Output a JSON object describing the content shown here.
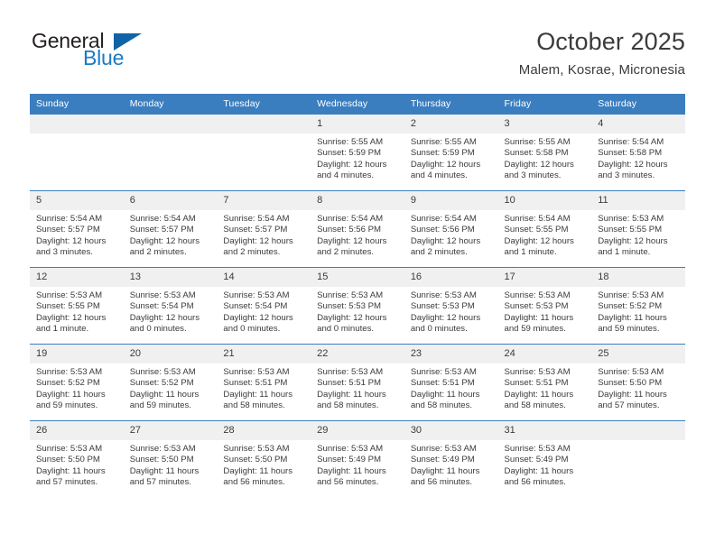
{
  "brand": {
    "name_part1": "General",
    "name_part2": "Blue",
    "accent_color": "#1a7bc4",
    "triangle_color": "#1263a5"
  },
  "header": {
    "title": "October 2025",
    "subtitle": "Malem, Kosrae, Micronesia"
  },
  "theme": {
    "header_row_bg": "#3b7ec0",
    "day_number_bg": "#f0f0f0",
    "grid_line": "#3b7ec0",
    "text": "#3b3b3b"
  },
  "weekday_headers": [
    "Sunday",
    "Monday",
    "Tuesday",
    "Wednesday",
    "Thursday",
    "Friday",
    "Saturday"
  ],
  "weeks": [
    [
      {
        "day": "",
        "empty": true,
        "sunrise": "",
        "sunset": "",
        "daylight1": "",
        "daylight2": ""
      },
      {
        "day": "",
        "empty": true,
        "sunrise": "",
        "sunset": "",
        "daylight1": "",
        "daylight2": ""
      },
      {
        "day": "",
        "empty": true,
        "sunrise": "",
        "sunset": "",
        "daylight1": "",
        "daylight2": ""
      },
      {
        "day": "1",
        "empty": false,
        "sunrise": "Sunrise: 5:55 AM",
        "sunset": "Sunset: 5:59 PM",
        "daylight1": "Daylight: 12 hours",
        "daylight2": "and 4 minutes."
      },
      {
        "day": "2",
        "empty": false,
        "sunrise": "Sunrise: 5:55 AM",
        "sunset": "Sunset: 5:59 PM",
        "daylight1": "Daylight: 12 hours",
        "daylight2": "and 4 minutes."
      },
      {
        "day": "3",
        "empty": false,
        "sunrise": "Sunrise: 5:55 AM",
        "sunset": "Sunset: 5:58 PM",
        "daylight1": "Daylight: 12 hours",
        "daylight2": "and 3 minutes."
      },
      {
        "day": "4",
        "empty": false,
        "sunrise": "Sunrise: 5:54 AM",
        "sunset": "Sunset: 5:58 PM",
        "daylight1": "Daylight: 12 hours",
        "daylight2": "and 3 minutes."
      }
    ],
    [
      {
        "day": "5",
        "empty": false,
        "sunrise": "Sunrise: 5:54 AM",
        "sunset": "Sunset: 5:57 PM",
        "daylight1": "Daylight: 12 hours",
        "daylight2": "and 3 minutes."
      },
      {
        "day": "6",
        "empty": false,
        "sunrise": "Sunrise: 5:54 AM",
        "sunset": "Sunset: 5:57 PM",
        "daylight1": "Daylight: 12 hours",
        "daylight2": "and 2 minutes."
      },
      {
        "day": "7",
        "empty": false,
        "sunrise": "Sunrise: 5:54 AM",
        "sunset": "Sunset: 5:57 PM",
        "daylight1": "Daylight: 12 hours",
        "daylight2": "and 2 minutes."
      },
      {
        "day": "8",
        "empty": false,
        "sunrise": "Sunrise: 5:54 AM",
        "sunset": "Sunset: 5:56 PM",
        "daylight1": "Daylight: 12 hours",
        "daylight2": "and 2 minutes."
      },
      {
        "day": "9",
        "empty": false,
        "sunrise": "Sunrise: 5:54 AM",
        "sunset": "Sunset: 5:56 PM",
        "daylight1": "Daylight: 12 hours",
        "daylight2": "and 2 minutes."
      },
      {
        "day": "10",
        "empty": false,
        "sunrise": "Sunrise: 5:54 AM",
        "sunset": "Sunset: 5:55 PM",
        "daylight1": "Daylight: 12 hours",
        "daylight2": "and 1 minute."
      },
      {
        "day": "11",
        "empty": false,
        "sunrise": "Sunrise: 5:53 AM",
        "sunset": "Sunset: 5:55 PM",
        "daylight1": "Daylight: 12 hours",
        "daylight2": "and 1 minute."
      }
    ],
    [
      {
        "day": "12",
        "empty": false,
        "sunrise": "Sunrise: 5:53 AM",
        "sunset": "Sunset: 5:55 PM",
        "daylight1": "Daylight: 12 hours",
        "daylight2": "and 1 minute."
      },
      {
        "day": "13",
        "empty": false,
        "sunrise": "Sunrise: 5:53 AM",
        "sunset": "Sunset: 5:54 PM",
        "daylight1": "Daylight: 12 hours",
        "daylight2": "and 0 minutes."
      },
      {
        "day": "14",
        "empty": false,
        "sunrise": "Sunrise: 5:53 AM",
        "sunset": "Sunset: 5:54 PM",
        "daylight1": "Daylight: 12 hours",
        "daylight2": "and 0 minutes."
      },
      {
        "day": "15",
        "empty": false,
        "sunrise": "Sunrise: 5:53 AM",
        "sunset": "Sunset: 5:53 PM",
        "daylight1": "Daylight: 12 hours",
        "daylight2": "and 0 minutes."
      },
      {
        "day": "16",
        "empty": false,
        "sunrise": "Sunrise: 5:53 AM",
        "sunset": "Sunset: 5:53 PM",
        "daylight1": "Daylight: 12 hours",
        "daylight2": "and 0 minutes."
      },
      {
        "day": "17",
        "empty": false,
        "sunrise": "Sunrise: 5:53 AM",
        "sunset": "Sunset: 5:53 PM",
        "daylight1": "Daylight: 11 hours",
        "daylight2": "and 59 minutes."
      },
      {
        "day": "18",
        "empty": false,
        "sunrise": "Sunrise: 5:53 AM",
        "sunset": "Sunset: 5:52 PM",
        "daylight1": "Daylight: 11 hours",
        "daylight2": "and 59 minutes."
      }
    ],
    [
      {
        "day": "19",
        "empty": false,
        "sunrise": "Sunrise: 5:53 AM",
        "sunset": "Sunset: 5:52 PM",
        "daylight1": "Daylight: 11 hours",
        "daylight2": "and 59 minutes."
      },
      {
        "day": "20",
        "empty": false,
        "sunrise": "Sunrise: 5:53 AM",
        "sunset": "Sunset: 5:52 PM",
        "daylight1": "Daylight: 11 hours",
        "daylight2": "and 59 minutes."
      },
      {
        "day": "21",
        "empty": false,
        "sunrise": "Sunrise: 5:53 AM",
        "sunset": "Sunset: 5:51 PM",
        "daylight1": "Daylight: 11 hours",
        "daylight2": "and 58 minutes."
      },
      {
        "day": "22",
        "empty": false,
        "sunrise": "Sunrise: 5:53 AM",
        "sunset": "Sunset: 5:51 PM",
        "daylight1": "Daylight: 11 hours",
        "daylight2": "and 58 minutes."
      },
      {
        "day": "23",
        "empty": false,
        "sunrise": "Sunrise: 5:53 AM",
        "sunset": "Sunset: 5:51 PM",
        "daylight1": "Daylight: 11 hours",
        "daylight2": "and 58 minutes."
      },
      {
        "day": "24",
        "empty": false,
        "sunrise": "Sunrise: 5:53 AM",
        "sunset": "Sunset: 5:51 PM",
        "daylight1": "Daylight: 11 hours",
        "daylight2": "and 58 minutes."
      },
      {
        "day": "25",
        "empty": false,
        "sunrise": "Sunrise: 5:53 AM",
        "sunset": "Sunset: 5:50 PM",
        "daylight1": "Daylight: 11 hours",
        "daylight2": "and 57 minutes."
      }
    ],
    [
      {
        "day": "26",
        "empty": false,
        "sunrise": "Sunrise: 5:53 AM",
        "sunset": "Sunset: 5:50 PM",
        "daylight1": "Daylight: 11 hours",
        "daylight2": "and 57 minutes."
      },
      {
        "day": "27",
        "empty": false,
        "sunrise": "Sunrise: 5:53 AM",
        "sunset": "Sunset: 5:50 PM",
        "daylight1": "Daylight: 11 hours",
        "daylight2": "and 57 minutes."
      },
      {
        "day": "28",
        "empty": false,
        "sunrise": "Sunrise: 5:53 AM",
        "sunset": "Sunset: 5:50 PM",
        "daylight1": "Daylight: 11 hours",
        "daylight2": "and 56 minutes."
      },
      {
        "day": "29",
        "empty": false,
        "sunrise": "Sunrise: 5:53 AM",
        "sunset": "Sunset: 5:49 PM",
        "daylight1": "Daylight: 11 hours",
        "daylight2": "and 56 minutes."
      },
      {
        "day": "30",
        "empty": false,
        "sunrise": "Sunrise: 5:53 AM",
        "sunset": "Sunset: 5:49 PM",
        "daylight1": "Daylight: 11 hours",
        "daylight2": "and 56 minutes."
      },
      {
        "day": "31",
        "empty": false,
        "sunrise": "Sunrise: 5:53 AM",
        "sunset": "Sunset: 5:49 PM",
        "daylight1": "Daylight: 11 hours",
        "daylight2": "and 56 minutes."
      },
      {
        "day": "",
        "empty": true,
        "sunrise": "",
        "sunset": "",
        "daylight1": "",
        "daylight2": ""
      }
    ]
  ]
}
